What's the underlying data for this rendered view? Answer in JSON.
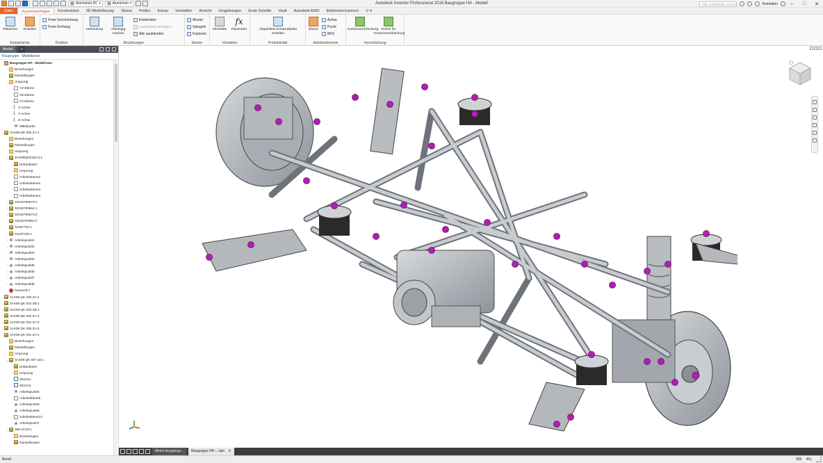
{
  "window": {
    "title": "Autodesk Inventor Professional 2018   Baugruppe HA - Modell",
    "material_combo": "Aluminium 6C",
    "appearance_combo": "Aluminium",
    "search_placeholder": "Hilfe und Befehle durchsuchen...",
    "signin": "Anmelden",
    "minimize": "–",
    "maximize": "□",
    "close": "✕"
  },
  "ribbon_tabs": [
    "Datei",
    "Zusammenfügen",
    "Konstruktion",
    "3D-Modellierung",
    "Skizze",
    "Prüfen",
    "Extras",
    "Verwalten",
    "Ansicht",
    "Umgebungen",
    "Erste Schritte",
    "Vault",
    "Autodesk A360",
    "Elektromechanisch"
  ],
  "ribbon": {
    "komponente": {
      "label": "Komponente",
      "platzieren": "Platzieren",
      "erstellen": "Erstellen"
    },
    "position": {
      "label": "Position",
      "freie_verschiebung": "Freie Verschiebung",
      "freie_drehung": "Freie Drehung"
    },
    "beziehungen": {
      "label": "Beziehungen",
      "verbindung": "Verbindung",
      "abhaengig": "Abhängig machen",
      "einblenden": "Einblenden",
      "langsam": "Langsamer anzeigen",
      "alle_ausblenden": "Alle ausblenden"
    },
    "muster": {
      "label": "Muster",
      "muster": "Muster",
      "spiegeln": "Spiegeln",
      "kopieren": "Kopieren"
    },
    "verwalten": {
      "label": "Verwalten",
      "stueckliste": "Stückliste",
      "parameter": "Parameter"
    },
    "produktivitaet": {
      "label": "Produktivität",
      "ersatz": "Abgeleitete Ersatzobjekte erstellen"
    },
    "arbeitselemente": {
      "label": "Arbeitselemente",
      "ebene": "Ebene",
      "achse": "Achse",
      "punkt": "Punkt",
      "bks": "BKS"
    },
    "vereinfachung": {
      "label": "Vereinfachung",
      "kontur": "Konturvereinfachung",
      "ersetz": "Ersetz für Konturvereinfachung"
    }
  },
  "browser": {
    "tabs": [
      "Modell",
      "+"
    ],
    "sub": [
      "Baugruppe",
      "Modellieren"
    ],
    "tree": [
      {
        "label": "Baugruppe HA - Modell.iam",
        "depth": 0,
        "icon": "part",
        "sel": true,
        "exp": ""
      },
      {
        "label": "Beziehungen",
        "depth": 1,
        "icon": "folder",
        "exp": "›"
      },
      {
        "label": "Darstellungen",
        "depth": 1,
        "icon": "check",
        "exp": "›"
      },
      {
        "label": "Ursprung",
        "depth": 1,
        "icon": "folder",
        "exp": "⌄"
      },
      {
        "label": "YZ-Ebene",
        "depth": 2,
        "icon": "plane",
        "exp": "›"
      },
      {
        "label": "XZ-Ebene",
        "depth": 2,
        "icon": "plane",
        "exp": "›"
      },
      {
        "label": "XY-Ebene",
        "depth": 2,
        "icon": "plane",
        "exp": "›"
      },
      {
        "label": "X-Achse",
        "depth": 2,
        "icon": "axis",
        "exp": "›"
      },
      {
        "label": "Y-Achse",
        "depth": 2,
        "icon": "axis",
        "exp": "›"
      },
      {
        "label": "Z-Achse",
        "depth": 2,
        "icon": "axis",
        "exp": "›"
      },
      {
        "label": "Mittelpunkt",
        "depth": 2,
        "icon": "point",
        "exp": ""
      },
      {
        "label": "3AX08 QK 006 ZA:1",
        "depth": 0,
        "icon": "check",
        "exp": "⌄"
      },
      {
        "label": "Beziehungen",
        "depth": 1,
        "icon": "folder",
        "exp": ""
      },
      {
        "label": "Darstellungen",
        "depth": 1,
        "icon": "check",
        "exp": ""
      },
      {
        "label": "Ursprung",
        "depth": 1,
        "icon": "folder",
        "exp": "›"
      },
      {
        "label": "3AX08QKD1(KA):1",
        "depth": 1,
        "icon": "check",
        "exp": "⌄"
      },
      {
        "label": "Drittanbieter",
        "depth": 2,
        "icon": "check",
        "exp": "›"
      },
      {
        "label": "Ursprung",
        "depth": 2,
        "icon": "folder",
        "exp": "›"
      },
      {
        "label": "Arbeitsebene1",
        "depth": 2,
        "icon": "plane",
        "exp": ""
      },
      {
        "label": "Arbeitsebene2",
        "depth": 2,
        "icon": "plane",
        "exp": ""
      },
      {
        "label": "Arbeitsebene3",
        "depth": 2,
        "icon": "plane",
        "exp": ""
      },
      {
        "label": "Arbeitsebene4",
        "depth": 2,
        "icon": "plane",
        "exp": ""
      },
      {
        "label": "33316790573:1",
        "depth": 1,
        "icon": "check",
        "exp": "›"
      },
      {
        "label": "33316793864:1",
        "depth": 1,
        "icon": "check",
        "exp": "›"
      },
      {
        "label": "33316790573:2",
        "depth": 1,
        "icon": "check",
        "exp": "›"
      },
      {
        "label": "33316793864:2",
        "depth": 1,
        "icon": "check",
        "exp": "›"
      },
      {
        "label": "31267732:1",
        "depth": 1,
        "icon": "check",
        "exp": "›"
      },
      {
        "label": "31437735:1",
        "depth": 1,
        "icon": "check",
        "exp": "›"
      },
      {
        "label": "Arbeitspunkt1",
        "depth": 1,
        "icon": "point",
        "exp": "›"
      },
      {
        "label": "Arbeitspunkt2",
        "depth": 1,
        "icon": "point",
        "exp": "›"
      },
      {
        "label": "Arbeitspunkt3",
        "depth": 1,
        "icon": "point",
        "exp": "›"
      },
      {
        "label": "Arbeitspunkt4",
        "depth": 1,
        "icon": "point",
        "exp": "›"
      },
      {
        "label": "Arbeitspunkt5",
        "depth": 1,
        "icon": "point",
        "exp": "›"
      },
      {
        "label": "Arbeitspunkt6",
        "depth": 1,
        "icon": "point",
        "exp": "›"
      },
      {
        "label": "Arbeitspunkt7",
        "depth": 1,
        "icon": "point",
        "exp": "›"
      },
      {
        "label": "Arbeitspunkt8",
        "depth": 1,
        "icon": "point",
        "exp": "›"
      },
      {
        "label": "Passend:7",
        "depth": 1,
        "icon": "pin",
        "exp": ""
      },
      {
        "label": "3AX08 QK 035 ZA:1",
        "depth": 0,
        "icon": "check",
        "exp": "›"
      },
      {
        "label": "3AX08 QK 034 ZB:1",
        "depth": 0,
        "icon": "check",
        "exp": "›"
      },
      {
        "label": "3AX08 QK 033 ZB:1",
        "depth": 0,
        "icon": "check",
        "exp": "›"
      },
      {
        "label": "3AX08 QK 032 ZA:1",
        "depth": 0,
        "icon": "check",
        "exp": "›"
      },
      {
        "label": "3AX08 QK 032 ZA:2",
        "depth": 0,
        "icon": "check",
        "exp": "›"
      },
      {
        "label": "3AX08 QK 035 ZA:2",
        "depth": 0,
        "icon": "check",
        "exp": "›"
      },
      {
        "label": "3AX08 QK 031 ZA:1",
        "depth": 0,
        "icon": "check",
        "exp": "⌄"
      },
      {
        "label": "Beziehungen",
        "depth": 1,
        "icon": "folder",
        "exp": ""
      },
      {
        "label": "Darstellungen",
        "depth": 1,
        "icon": "check",
        "exp": ""
      },
      {
        "label": "Ursprung",
        "depth": 1,
        "icon": "folder",
        "exp": "›"
      },
      {
        "label": "3AX08 QK 007 LB:1",
        "depth": 1,
        "icon": "check",
        "exp": "⌄"
      },
      {
        "label": "Drittanbieter",
        "depth": 2,
        "icon": "check",
        "exp": "›"
      },
      {
        "label": "Ursprung",
        "depth": 2,
        "icon": "folder",
        "exp": "›"
      },
      {
        "label": "Skizze1",
        "depth": 2,
        "icon": "sketch",
        "exp": ""
      },
      {
        "label": "Skizze2",
        "depth": 2,
        "icon": "sketch",
        "exp": ""
      },
      {
        "label": "Arbeitspunkt4",
        "depth": 2,
        "icon": "point",
        "exp": ""
      },
      {
        "label": "Arbeitsebene5",
        "depth": 2,
        "icon": "plane",
        "exp": ""
      },
      {
        "label": "Arbeitspunkt5",
        "depth": 2,
        "icon": "point",
        "exp": ""
      },
      {
        "label": "Arbeitspunkt6",
        "depth": 2,
        "icon": "point",
        "exp": ""
      },
      {
        "label": "Arbeitsebene13",
        "depth": 2,
        "icon": "plane",
        "exp": ""
      },
      {
        "label": "Arbeitspunkt7",
        "depth": 2,
        "icon": "point",
        "exp": ""
      },
      {
        "label": "389.13.03:1",
        "depth": 1,
        "icon": "check",
        "exp": "⌄"
      },
      {
        "label": "Beziehungen",
        "depth": 2,
        "icon": "folder",
        "exp": ""
      },
      {
        "label": "Darstellungen",
        "depth": 2,
        "icon": "check",
        "exp": ""
      }
    ]
  },
  "doc_tabs": [
    "Meine Ausgangs...",
    "Baugruppe HA -...iam"
  ],
  "status": {
    "text": "Bereit",
    "n1": "805",
    "n2": "461"
  },
  "colors": {
    "file_tab": "#e8632a",
    "bolt": "#b21fb0",
    "frame": "#b9bcc1"
  }
}
